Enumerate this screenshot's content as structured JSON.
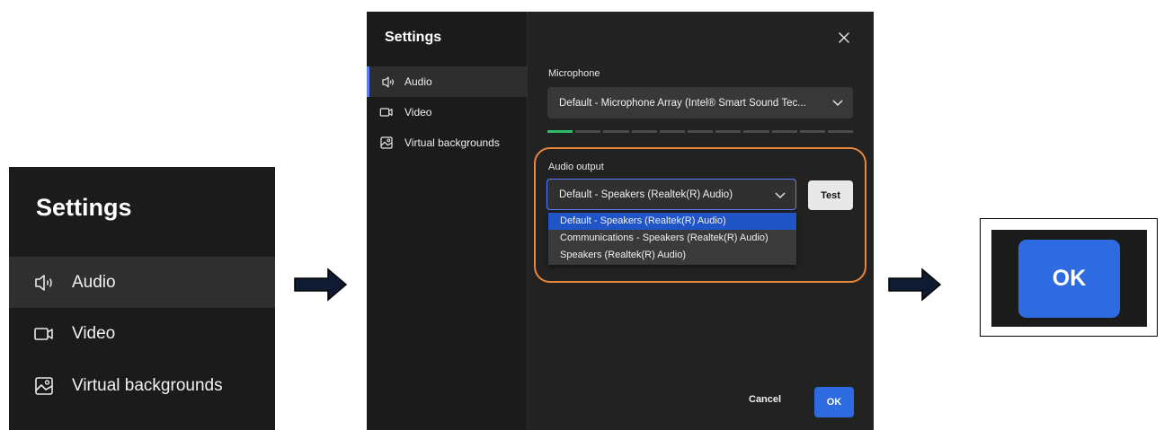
{
  "zoom_sidebar": {
    "title": "Settings",
    "items": [
      {
        "label": "Audio",
        "icon": "speaker-icon",
        "active": true
      },
      {
        "label": "Video",
        "icon": "video-camera-icon",
        "active": false
      },
      {
        "label": "Virtual backgrounds",
        "icon": "image-icon",
        "active": false
      }
    ]
  },
  "dialog": {
    "title": "Settings",
    "nav": [
      {
        "label": "Audio",
        "icon": "speaker-icon",
        "active": true
      },
      {
        "label": "Video",
        "icon": "video-camera-icon",
        "active": false
      },
      {
        "label": "Virtual backgrounds",
        "icon": "image-icon",
        "active": false
      }
    ],
    "microphone": {
      "label": "Microphone",
      "value": "Default - Microphone Array (Intel® Smart Sound Tec...",
      "level_segments_total": 11,
      "level_segments_active": 1
    },
    "audio_output": {
      "label": "Audio output",
      "value": "Default - Speakers (Realtek(R) Audio)",
      "options": [
        "Default - Speakers (Realtek(R) Audio)",
        "Communications - Speakers (Realtek(R) Audio)",
        "Speakers (Realtek(R) Audio)"
      ],
      "selected_index": 0
    },
    "test_label": "Test",
    "cancel_label": "Cancel",
    "ok_label": "OK"
  },
  "zoom_ok": {
    "label": "OK"
  },
  "colors": {
    "accent_blue": "#2f6be0",
    "highlight_orange": "#e8873c",
    "meter_green": "#2ebd6a",
    "panel_dark": "#1b1b1b"
  }
}
